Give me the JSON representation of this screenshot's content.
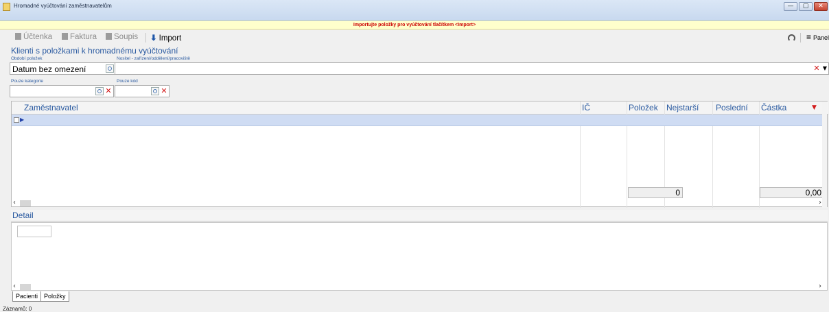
{
  "window": {
    "title": "Hromadné vyúčtování zaměstnavatelům",
    "controls": {
      "minimize": "—",
      "maximize": "▢",
      "close": "✕"
    }
  },
  "banner": {
    "text": "Importujte položky pro vyúčtování tlačítkem <Import>"
  },
  "toolbar": {
    "uctenka": "Účtenka",
    "faktura": "Faktura",
    "soupis": "Soupis",
    "import": "Import",
    "panel": "Panel"
  },
  "section": {
    "title": "Klienti s položkami k hromadnému vyúčtování"
  },
  "filters": {
    "obdobi_label": "Období položek",
    "obdobi_value": "Datum bez omezení",
    "nositel_label": "Nositel - zařízení/oddělení/pracoviště",
    "nositel_value": "",
    "kategorie_label": "Pouze kategorie",
    "kategorie_value": "",
    "kod_label": "Pouze kód",
    "kod_value": ""
  },
  "grid": {
    "columns": [
      "Zaměstnavatel",
      "IČ",
      "Položek",
      "Nejstarší",
      "Poslední",
      "Částka"
    ],
    "rows": [],
    "totals": {
      "polozek": "0",
      "castka": "0,00"
    }
  },
  "detail": {
    "title": "Detail"
  },
  "tabs": [
    "Pacienti",
    "Položky"
  ],
  "status": {
    "records": "Záznamů: 0"
  }
}
